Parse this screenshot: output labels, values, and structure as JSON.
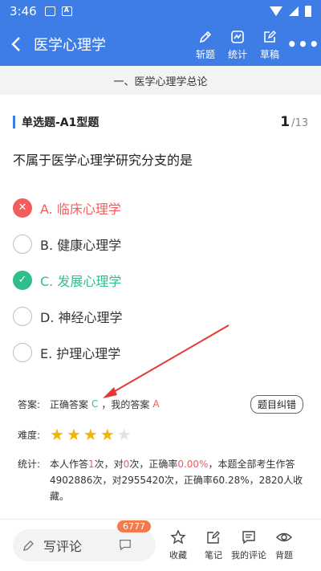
{
  "status": {
    "time": "3:46"
  },
  "header": {
    "title": "医学心理学",
    "actions": [
      {
        "label": "斩题",
        "icon": "pen-icon"
      },
      {
        "label": "统计",
        "icon": "chart-icon"
      },
      {
        "label": "草稿",
        "icon": "draft-icon"
      }
    ],
    "more": "•••"
  },
  "section": {
    "title": "一、医学心理学总论"
  },
  "question": {
    "type": "单选题-A1型题",
    "current": "1",
    "total": "/13",
    "text": "不属于医学心理学研究分支的是",
    "options": [
      {
        "label": "A. 临床心理学",
        "state": "wrong",
        "mark": "✕"
      },
      {
        "label": "B. 健康心理学",
        "state": "normal",
        "mark": ""
      },
      {
        "label": "C. 发展心理学",
        "state": "right",
        "mark": "✓"
      },
      {
        "label": "D. 神经心理学",
        "state": "normal",
        "mark": ""
      },
      {
        "label": "E. 护理心理学",
        "state": "normal",
        "mark": ""
      }
    ]
  },
  "answer": {
    "label": "答案:",
    "correct_prefix": "正确答案",
    "correct": "C",
    "mine_prefix": "，我的答案",
    "mine": "A",
    "report_button": "题目纠错"
  },
  "difficulty": {
    "label": "难度:",
    "rating": 4,
    "max": 5
  },
  "stats": {
    "label": "统计:",
    "p1": "本人作答",
    "times": "1",
    "p2": "次，对",
    "right": "0",
    "p3": "次，正确率",
    "rate": "0.00%",
    "p4": "，本题全部考生作答4902886次，对2955420次，正确率60.28%，2820人收藏。"
  },
  "bottom": {
    "comment_placeholder": "写评论",
    "comment_count": "6777",
    "actions": [
      {
        "label": "收藏",
        "icon": "star-outline-icon"
      },
      {
        "label": "笔记",
        "icon": "note-icon"
      },
      {
        "label": "我的评论",
        "icon": "comment-icon"
      },
      {
        "label": "背题",
        "icon": "eye-icon"
      }
    ]
  },
  "colors": {
    "brand": "#3f7de6",
    "wrong": "#f35c5c",
    "right": "#2fbf8a",
    "star": "#f4b400",
    "arrow": "#e53935"
  }
}
